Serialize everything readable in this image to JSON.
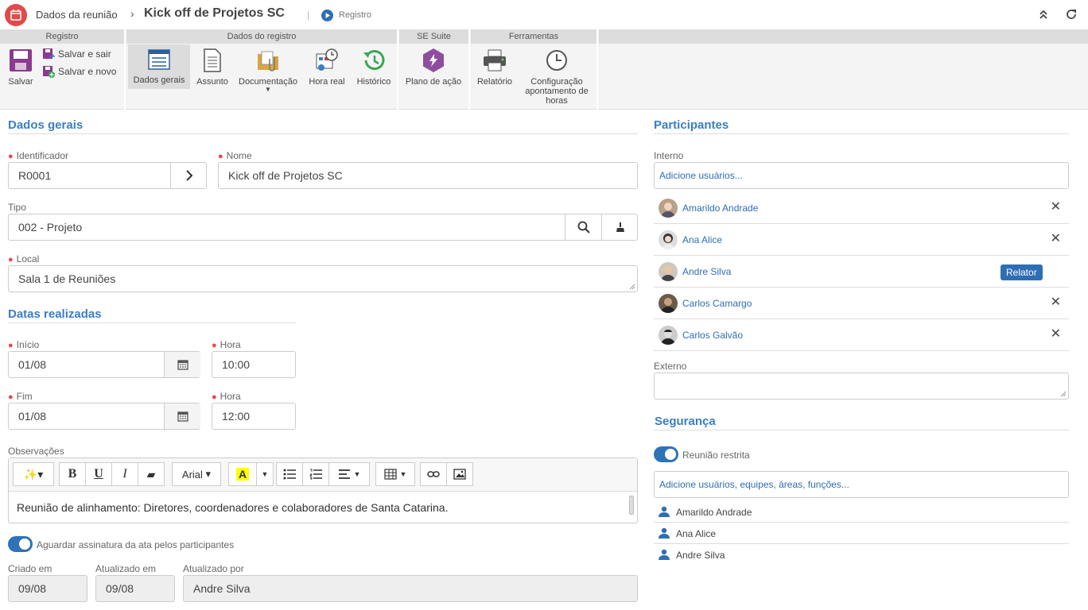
{
  "header": {
    "crumb_parent": "Dados da reunião",
    "crumb_separator": "›",
    "title": "Kick off de Projetos SC",
    "divider": "|",
    "registro_link": "Registro"
  },
  "ribbon": {
    "groups": {
      "registro": "Registro",
      "dados_registro": "Dados do registro",
      "se_suite": "SE Suite",
      "ferramentas": "Ferramentas"
    },
    "buttons": {
      "salvar": "Salvar",
      "salvar_sair": "Salvar e sair",
      "salvar_novo": "Salvar e novo",
      "dados_gerais": "Dados gerais",
      "assunto": "Assunto",
      "documentacao": "Documentação",
      "hora_real": "Hora real",
      "historico": "Histórico",
      "plano_acao": "Plano de ação",
      "relatorio": "Relatório",
      "config_1": "Configuração",
      "config_2": "apontamento de",
      "config_3": "horas"
    }
  },
  "dados_gerais": {
    "title": "Dados gerais",
    "identificador_label": "Identificador",
    "identificador_value": "R0001",
    "nome_label": "Nome",
    "nome_value": "Kick off de Projetos SC",
    "tipo_label": "Tipo",
    "tipo_value": "002 - Projeto",
    "local_label": "Local",
    "local_value": "Sala 1 de Reuniões"
  },
  "datas": {
    "title": "Datas realizadas",
    "inicio_label": "Início",
    "inicio_value": "01/08",
    "hora_inicio_label": "Hora",
    "hora_inicio_value": "10:00",
    "fim_label": "Fim",
    "fim_value": "01/08",
    "hora_fim_label": "Hora",
    "hora_fim_value": "12:00"
  },
  "observacoes": {
    "label": "Observações",
    "font": "Arial",
    "text": "Reunião de alinhamento:  Diretores, coordenadores e colaboradores de Santa Catarina."
  },
  "assinatura": {
    "label": "Aguardar assinatura da ata pelos participantes",
    "enabled": true
  },
  "meta": {
    "criado_label": "Criado em",
    "criado_value": "09/08",
    "atualizado_label": "Atualizado em",
    "atualizado_value": "09/08",
    "atualizado_por_label": "Atualizado por",
    "atualizado_por_value": "Andre Silva"
  },
  "participantes": {
    "title": "Participantes",
    "interno_label": "Interno",
    "interno_placeholder": "Adicione usuários...",
    "list": [
      {
        "name": "Amarildo Andrade",
        "role": ""
      },
      {
        "name": "Ana Alice",
        "role": ""
      },
      {
        "name": "Andre Silva",
        "role": "Relator"
      },
      {
        "name": "Carlos Camargo",
        "role": ""
      },
      {
        "name": "Carlos Galvão",
        "role": ""
      }
    ],
    "externo_label": "Externo"
  },
  "seguranca": {
    "title": "Segurança",
    "restrita_label": "Reunião restrita",
    "restrita_enabled": true,
    "add_placeholder": "Adicione usuários, equipes, áreas, funções...",
    "users": [
      "Amarildo Andrade",
      "Ana Alice",
      "Andre Silva"
    ]
  },
  "colors": {
    "accent": "#3a7ec5",
    "link": "#2e6eb5",
    "required": "#ee4444",
    "app_icon": "#e04a4a"
  }
}
